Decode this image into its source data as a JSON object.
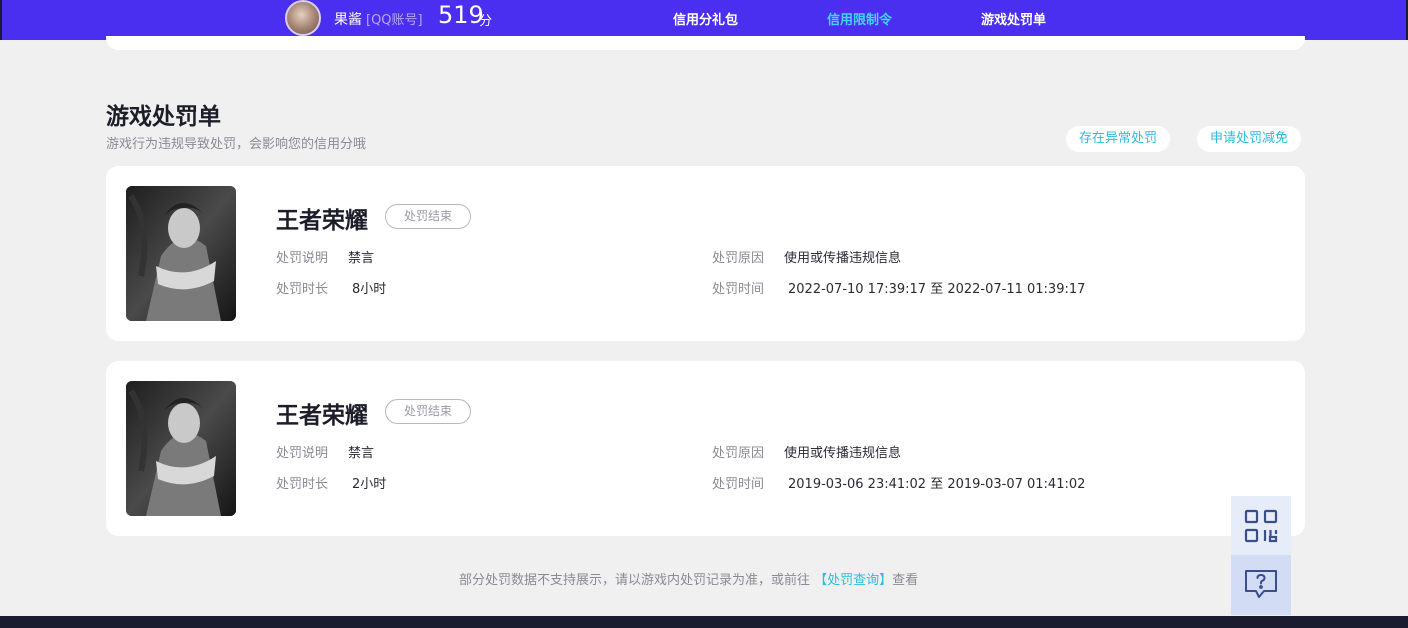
{
  "header": {
    "username": "果酱",
    "account_tag": "[QQ账号]",
    "score": "519",
    "score_unit": "分",
    "nav": [
      {
        "label": "信用分礼包",
        "active": false
      },
      {
        "label": "信用限制令",
        "active": true
      },
      {
        "label": "游戏处罚单",
        "active": false
      }
    ]
  },
  "section": {
    "title": "游戏处罚单",
    "subtitle": "游戏行为违规导致处罚，会影响您的信用分哦",
    "btn_abnormal": "存在异常处罚",
    "btn_reduce": "申请处罚减免"
  },
  "labels": {
    "desc": "处罚说明",
    "reason": "处罚原因",
    "duration": "处罚时长",
    "time": "处罚时间"
  },
  "records": [
    {
      "game": "王者荣耀",
      "status": "处罚结束",
      "desc": "禁言",
      "reason": "使用或传播违规信息",
      "duration": "8小时",
      "time": "2022-07-10 17:39:17 至 2022-07-11 01:39:17"
    },
    {
      "game": "王者荣耀",
      "status": "处罚结束",
      "desc": "禁言",
      "reason": "使用或传播违规信息",
      "duration": "2小时",
      "time": "2019-03-06 23:41:02 至 2019-03-07 01:41:02"
    }
  ],
  "footer": {
    "note_prefix": "部分处罚数据不支持展示，请以游戏内处罚记录为准，或前往",
    "link": "【处罚查询】",
    "note_suffix": "查看"
  },
  "float": {
    "qr_icon": "qr-code-icon",
    "help_icon": "feedback-question-icon"
  },
  "colors": {
    "brand": "#4a2ff0",
    "accent": "#42d4f4",
    "link": "#2bbde0",
    "page_bg": "#f0f0f0"
  }
}
